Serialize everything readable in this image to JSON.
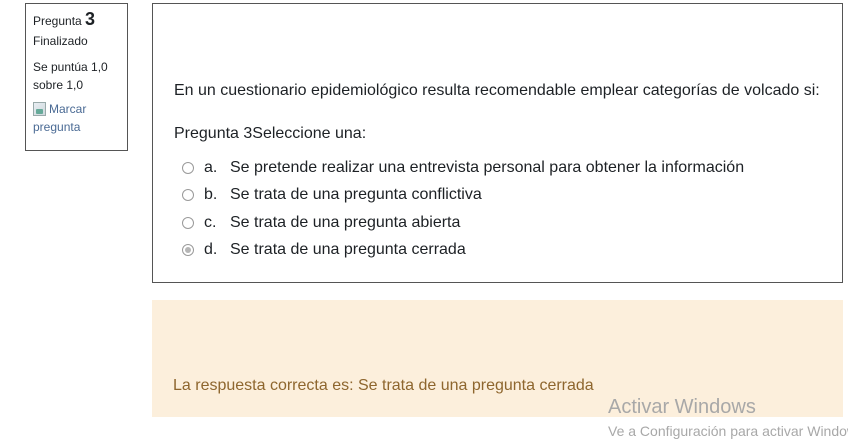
{
  "info": {
    "question_label": "Pregunta",
    "question_number": "3",
    "state": "Finalizado",
    "grade": "Se puntúa 1,0 sobre 1,0",
    "flag_icon": "flag-image-icon",
    "flag_label": "Marcar pregunta"
  },
  "question": {
    "text": "En un cuestionario epidemiológico resulta recomendable emplear categorías de volcado si:",
    "prompt": "Pregunta 3Seleccione una:",
    "answers": [
      {
        "letter": "a.",
        "text": "Se pretende realizar una entrevista personal para obtener la información",
        "checked": false
      },
      {
        "letter": "b.",
        "text": "Se trata de una pregunta conflictiva",
        "checked": false
      },
      {
        "letter": "c.",
        "text": "Se trata de una pregunta abierta",
        "checked": false
      },
      {
        "letter": "d.",
        "text": "Se trata de una pregunta cerrada",
        "checked": true
      }
    ]
  },
  "feedback": {
    "right_answer": "La respuesta correcta es: Se trata de una pregunta cerrada"
  },
  "watermark": {
    "title": "Activar Windows",
    "subtitle": "Ve a Configuración para activar Windows."
  },
  "colors": {
    "feedback_bg": "#fcefdc",
    "feedback_text": "#8e662e",
    "link": "#4a6a94"
  }
}
